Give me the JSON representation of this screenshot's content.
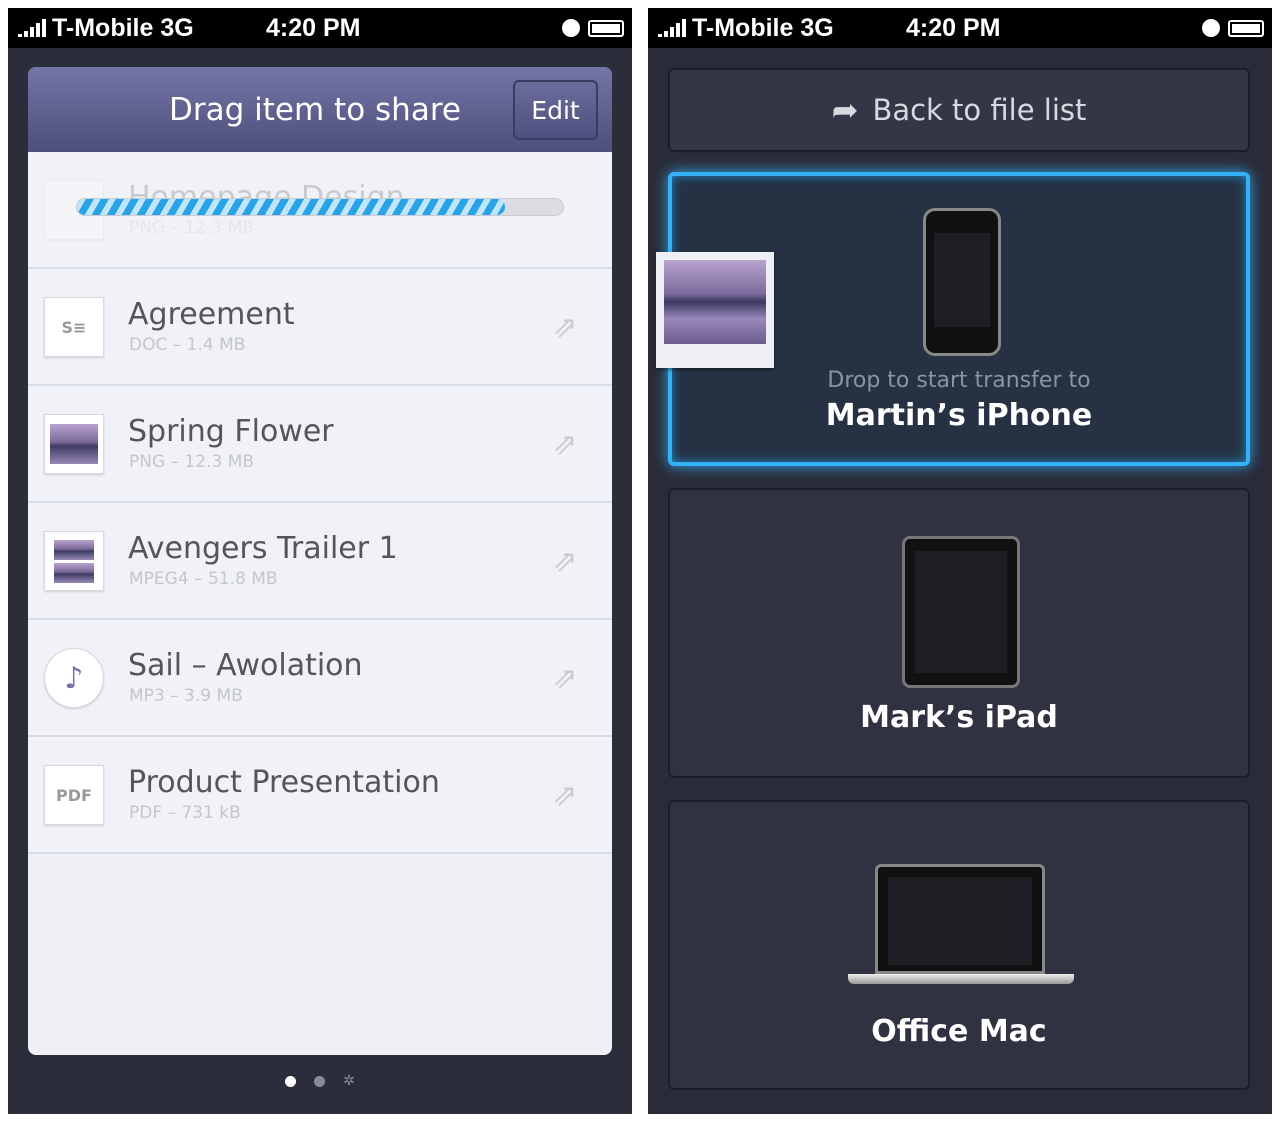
{
  "status_bar": {
    "carrier": "T-Mobile 3G",
    "time": "4:20 PM"
  },
  "left": {
    "header": {
      "title": "Drag item to share",
      "edit_label": "Edit"
    },
    "uploading": {
      "name": "Homepage Design",
      "meta": "PNG – 12.3 MB",
      "progress": 0.88
    },
    "files": [
      {
        "name": "Agreement",
        "meta": "DOC – 1.4 MB",
        "icon": "document-icon"
      },
      {
        "name": "Spring Flower",
        "meta": "PNG – 12.3 MB",
        "icon": "image-icon"
      },
      {
        "name": "Avengers Trailer 1",
        "meta": "MPEG4 – 51.8 MB",
        "icon": "video-icon"
      },
      {
        "name": "Sail – Awolation",
        "meta": "MP3 – 3.9 MB",
        "icon": "music-icon"
      },
      {
        "name": "Product Presentation",
        "meta": "PDF – 731 kB",
        "icon": "pdf-icon",
        "thumb_text": "PDF"
      }
    ],
    "page_indicator": {
      "pages": 2,
      "current": 1,
      "share_glyph": "⇪",
      "settings_glyph": "✲"
    }
  },
  "right": {
    "back_label": "Back to file list",
    "devices": [
      {
        "prompt": "Drop to start transfer to",
        "name": "Martin’s iPhone",
        "active": true
      },
      {
        "name": "Mark’s iPad"
      },
      {
        "name": "Office Mac"
      }
    ],
    "accent": "#34b2f5"
  }
}
